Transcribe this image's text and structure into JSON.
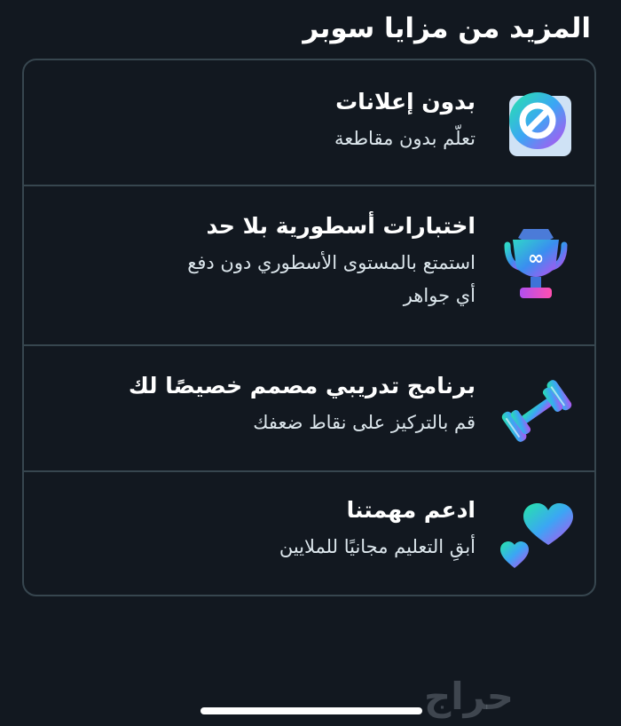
{
  "page": {
    "title": "المزيد من مزايا سوبر"
  },
  "features": [
    {
      "title": "بدون إعلانات",
      "subtitle": "تعلّم بدون مقاطعة",
      "icon": "no-ads-icon"
    },
    {
      "title": "اختبارات أسطورية بلا حد",
      "subtitle": "استمتع بالمستوى الأسطوري دون دفع\nأي جواهر",
      "icon": "trophy-icon"
    },
    {
      "title": "برنامج تدريبي مصمم خصيصًا لك",
      "subtitle": "قم بالتركيز على نقاط ضعفك",
      "icon": "dumbbell-icon"
    },
    {
      "title": "ادعم مهمتنا",
      "subtitle": "أبقِ التعليم مجانيًا للملايين",
      "icon": "hearts-icon"
    }
  ],
  "watermark": {
    "text": "حراج"
  },
  "colors": {
    "background": "#121820",
    "border": "#37464f",
    "text": "#ffffff",
    "subtext": "#dce6ec",
    "gradient_start": "#26e5a9",
    "gradient_mid": "#3ba6f4",
    "gradient_end": "#c04bf0"
  }
}
